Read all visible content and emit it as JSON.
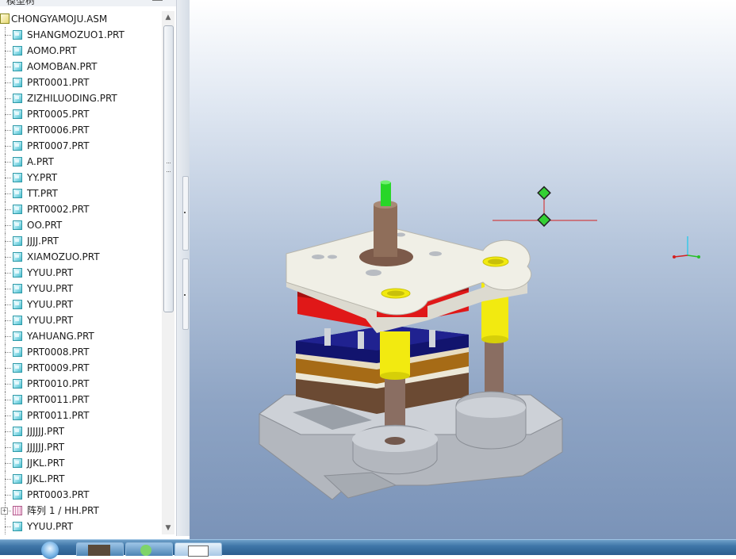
{
  "panel": {
    "title": "模型树"
  },
  "tree": {
    "root": "CHONGYAMOJU.ASM",
    "items": [
      {
        "label": "SHANGMOZUO1.PRT",
        "icon": "part-icon"
      },
      {
        "label": "AOMO.PRT",
        "icon": "part-icon"
      },
      {
        "label": "AOMOBAN.PRT",
        "icon": "part-icon"
      },
      {
        "label": "PRT0001.PRT",
        "icon": "part-icon"
      },
      {
        "label": "ZIZHILUODING.PRT",
        "icon": "part-icon"
      },
      {
        "label": "PRT0005.PRT",
        "icon": "part-icon"
      },
      {
        "label": "PRT0006.PRT",
        "icon": "part-icon"
      },
      {
        "label": "PRT0007.PRT",
        "icon": "part-icon"
      },
      {
        "label": "A.PRT",
        "icon": "part-icon"
      },
      {
        "label": "YY.PRT",
        "icon": "part-icon"
      },
      {
        "label": "TT.PRT",
        "icon": "part-icon"
      },
      {
        "label": "PRT0002.PRT",
        "icon": "part-icon"
      },
      {
        "label": "OO.PRT",
        "icon": "part-icon"
      },
      {
        "label": "JJJJ.PRT",
        "icon": "part-icon"
      },
      {
        "label": "XIAMOZUO.PRT",
        "icon": "part-icon"
      },
      {
        "label": "YYUU.PRT",
        "icon": "part-icon"
      },
      {
        "label": "YYUU.PRT",
        "icon": "part-icon"
      },
      {
        "label": "YYUU.PRT",
        "icon": "part-icon"
      },
      {
        "label": "YYUU.PRT",
        "icon": "part-icon"
      },
      {
        "label": "YAHUANG.PRT",
        "icon": "part-icon"
      },
      {
        "label": "PRT0008.PRT",
        "icon": "part-icon"
      },
      {
        "label": "PRT0009.PRT",
        "icon": "part-icon"
      },
      {
        "label": "PRT0010.PRT",
        "icon": "part-icon"
      },
      {
        "label": "PRT0011.PRT",
        "icon": "part-icon"
      },
      {
        "label": "PRT0011.PRT",
        "icon": "part-icon"
      },
      {
        "label": "JJJJJJ.PRT",
        "icon": "part-icon"
      },
      {
        "label": "JJJJJJ.PRT",
        "icon": "part-icon"
      },
      {
        "label": "JJKL.PRT",
        "icon": "part-icon"
      },
      {
        "label": "JJKL.PRT",
        "icon": "part-icon"
      },
      {
        "label": "PRT0003.PRT",
        "icon": "part-icon"
      },
      {
        "label": "阵列 1 / HH.PRT",
        "icon": "pattern-icon"
      },
      {
        "label": "YYUU.PRT",
        "icon": "part-icon"
      }
    ]
  },
  "colors": {
    "viewport_top": "#ffffff",
    "viewport_bottom": "#7a93b8",
    "die_plate": "#f0efe6",
    "guide_post": "#8a6e62",
    "bushing": "#f2ea10",
    "punch": "#28d628",
    "red_plate": "#e01818",
    "navy_plate": "#12146e",
    "base": "#b8bcc2"
  }
}
